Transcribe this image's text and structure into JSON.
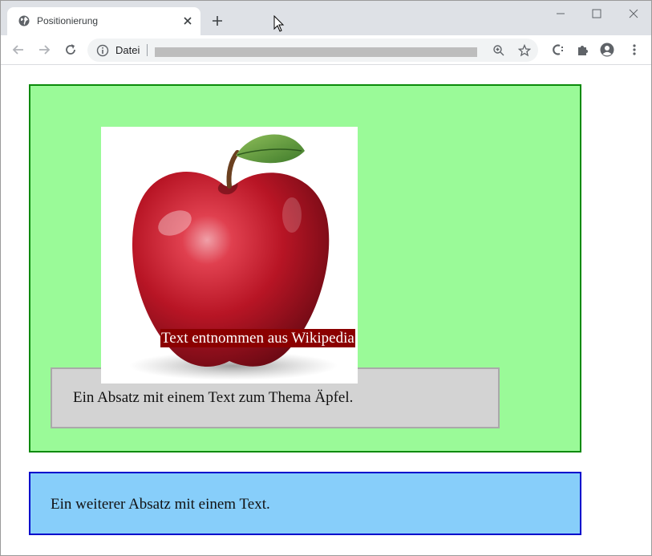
{
  "browser": {
    "tab": {
      "title": "Positionierung",
      "favicon": "globe-icon"
    },
    "new_tab_icon": "plus-icon",
    "window_controls": [
      "minimize-icon",
      "maximize-icon",
      "close-icon"
    ],
    "omnibox": {
      "security_label": "Datei",
      "url": ""
    },
    "toolbar_icons": [
      "zoom-icon",
      "star-icon",
      "extension-c-icon",
      "puzzle-icon",
      "profile-icon",
      "menu-icon"
    ]
  },
  "page": {
    "image_caption": "Text entnommen aus Wikipedia",
    "paragraph_1": "Ein Absatz mit einem Text zum Thema Äpfel.",
    "paragraph_2": "Ein weiterer Absatz mit einem Text."
  },
  "colors": {
    "green_box_bg": "#9afa98",
    "green_box_border": "#0a8a0a",
    "gray_para_bg": "#d3d3d3",
    "caption_bg": "#8b0000",
    "blue_box_bg": "#87cefa",
    "blue_box_border": "#0000cc"
  }
}
